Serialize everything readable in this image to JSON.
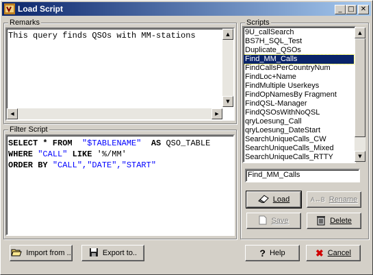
{
  "window": {
    "title": "Load Script"
  },
  "remarks": {
    "label": "Remarks",
    "text": "This query finds QSOs with MM-stations"
  },
  "filter": {
    "label": "Filter Script",
    "lines": [
      [
        {
          "t": "SELECT * FROM ",
          "k": "keyword"
        },
        {
          "t": " \"$TABLENAME\" ",
          "k": "str"
        },
        {
          "t": " AS ",
          "k": "keyword"
        },
        {
          "t": "QSO_TABLE",
          "k": ""
        }
      ],
      [
        {
          "t": "WHERE ",
          "k": "keyword"
        },
        {
          "t": "\"CALL\"",
          "k": "str"
        },
        {
          "t": " LIKE ",
          "k": "keyword"
        },
        {
          "t": "'%/MM'",
          "k": ""
        }
      ],
      [
        {
          "t": "ORDER BY ",
          "k": "keyword"
        },
        {
          "t": "\"CALL\",\"DATE\",\"START\"",
          "k": "str"
        }
      ]
    ]
  },
  "scripts": {
    "label": "Scripts",
    "items": [
      "9U_callSearch",
      "BS7H_SQL_Test",
      "Duplicate_QSOs",
      "Find_MM_Calls",
      "FindCallsPerCountryNum",
      "FindLoc+Name",
      "FindMultiple Userkeys",
      "FindOpNamesBy Fragment",
      "FindQSL-Manager",
      "FindQSOsWithNoQSL",
      "qryLoesung_Call",
      "qryLoesung_DateStart",
      "SearchUniqueCalls_CW",
      "SearchUniqueCalls_Mixed",
      "SearchUniqueCalls_RTTY"
    ],
    "selected_index": 3,
    "name_value": "Find_MM_Calls"
  },
  "buttons": {
    "load": "Load",
    "rename": "Rename",
    "save": "Save",
    "delete": "Delete",
    "import": "Import from ..",
    "export": "Export to..",
    "help": "Help",
    "cancel": "Cancel"
  },
  "icons": {
    "app": "app-icon",
    "minimize": "minimize-icon",
    "maximize": "maximize-icon",
    "close": "close-icon"
  }
}
